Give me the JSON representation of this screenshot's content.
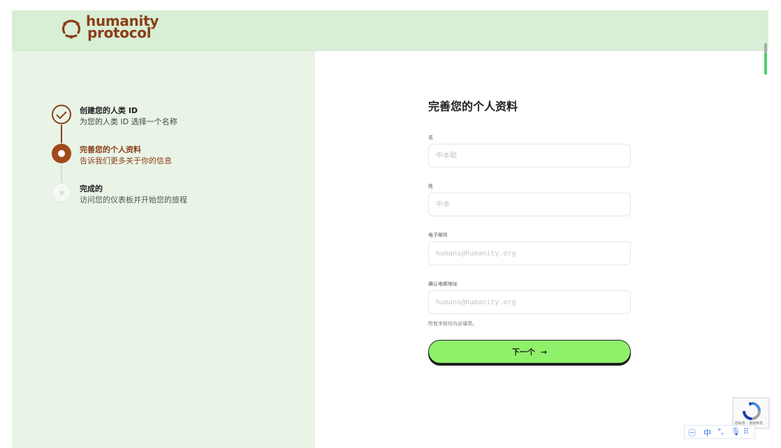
{
  "brand": {
    "line1": "humanity",
    "line2": "protocol",
    "color": "#8b3e18"
  },
  "colors": {
    "header_bg": "#d9eed6",
    "left_bg": "#e9f4e7",
    "accent": "#a14a1c",
    "button_bg": "#8ff06a"
  },
  "steps": [
    {
      "title": "创建您的人类 ID",
      "subtitle": "为您的人类 ID 选择一个名称",
      "state": "completed"
    },
    {
      "title": "完善您的个人资料",
      "subtitle": "告诉我们更多关于你的信息",
      "state": "active"
    },
    {
      "title": "完成的",
      "subtitle": "访问您的仪表板并开始您的旅程",
      "state": "pending"
    }
  ],
  "form": {
    "title": "完善您的个人资料",
    "fields": [
      {
        "label": "名",
        "placeholder": "中本聪",
        "value": ""
      },
      {
        "label": "姓",
        "placeholder": "中本",
        "value": ""
      },
      {
        "label": "电子邮件",
        "placeholder": "humans@humanity.org",
        "value": ""
      },
      {
        "label": "确认电邮地址",
        "placeholder": "humans@humanity.org",
        "value": ""
      }
    ],
    "required_note": "所有字段均为必填项。",
    "next_label": "下一个",
    "next_arrow": "→"
  },
  "recaptcha": {
    "text": "隐私权 - 使用条款"
  },
  "ime_toolbar": {
    "mode": "中",
    "punct": "°,",
    "mic": "🎙",
    "grid": "⠿"
  }
}
